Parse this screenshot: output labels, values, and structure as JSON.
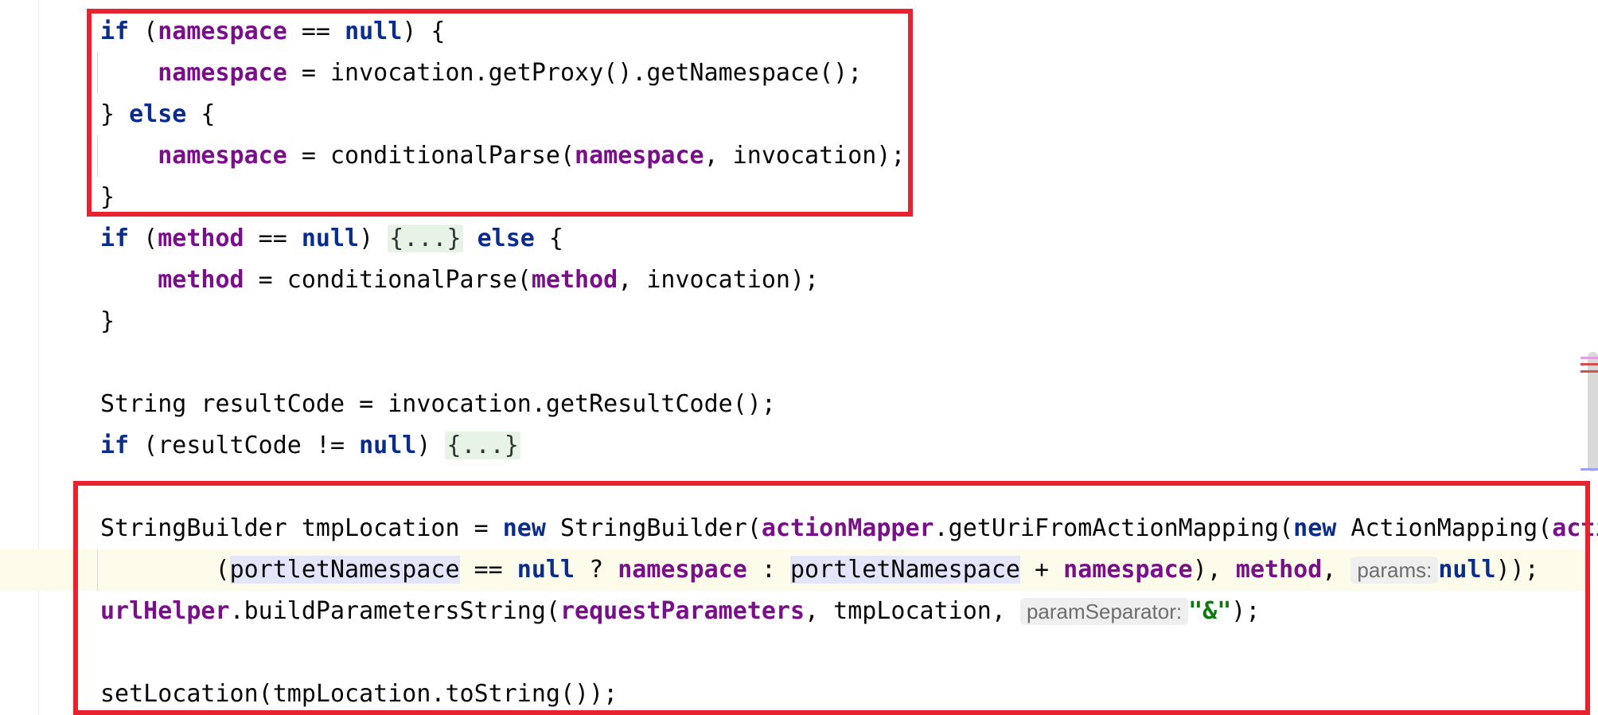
{
  "editor": {
    "lines": {
      "l0": {
        "kw_if": "if",
        "p1": " (",
        "f_ns": "namespace",
        "p2": " == ",
        "kw_null": "null",
        "p3": ") {"
      },
      "l1": {
        "f_ns": "namespace",
        "p1": " = invocation.getProxy().getNamespace();"
      },
      "l2": {
        "p1": "} ",
        "kw_else": "else",
        "p2": " {"
      },
      "l3": {
        "f_ns": "namespace",
        "p1": " = conditionalParse(",
        "f_ns2": "namespace",
        "p2": ", invocation);"
      },
      "l4": {
        "p1": "}"
      },
      "l5": {
        "kw_if": "if",
        "p1": " (",
        "f_method": "method",
        "p2": " == ",
        "kw_null": "null",
        "p3": ") ",
        "fold": "{...}",
        "p4": " ",
        "kw_else": "else",
        "p5": " {"
      },
      "l6": {
        "f_method": "method",
        "p1": " = conditionalParse(",
        "f_method2": "method",
        "p2": ", invocation);"
      },
      "l7": {
        "p1": "}"
      },
      "l9": {
        "p1": "String resultCode = invocation.getResultCode();"
      },
      "l10": {
        "kw_if": "if",
        "p1": " (resultCode != ",
        "kw_null": "null",
        "p2": ") ",
        "fold": "{...}"
      },
      "l12": {
        "p1": "StringBuilder tmpLocation = ",
        "kw_new": "new",
        "p2": " StringBuilder(",
        "f_am": "actionMapper",
        "p3": ".getUriFromActionMapping(",
        "kw_new2": "new",
        "p4": " ActionMapping(",
        "f_cut": "acti"
      },
      "l13": {
        "p1": "(",
        "h_pn": "portletNamespace",
        "p2": " == ",
        "kw_null": "null",
        "p3": " ? ",
        "f_ns": "namespace",
        "p4": " : ",
        "h_pn2": "portletNamespace",
        "p5": " + ",
        "f_ns2": "namespace",
        "p6": "), ",
        "f_method": "method",
        "p7": ", ",
        "hint_params": "params:",
        "kw_null2": "null",
        "p8": "));"
      },
      "l14": {
        "f_uh": "urlHelper",
        "p1": ".buildParametersString(",
        "f_rp": "requestParameters",
        "p2": ", tmpLocation, ",
        "hint_sep": "paramSeparator:",
        "str_amp": "\"&\"",
        "p3": ");"
      },
      "l16": {
        "p1": "setLocation(tmpLocation.toString());"
      }
    }
  },
  "colors": {
    "keyword": "#0a2c8c",
    "field": "#7a0f8a",
    "string": "#107a10",
    "annotation_box": "#e8222e"
  }
}
